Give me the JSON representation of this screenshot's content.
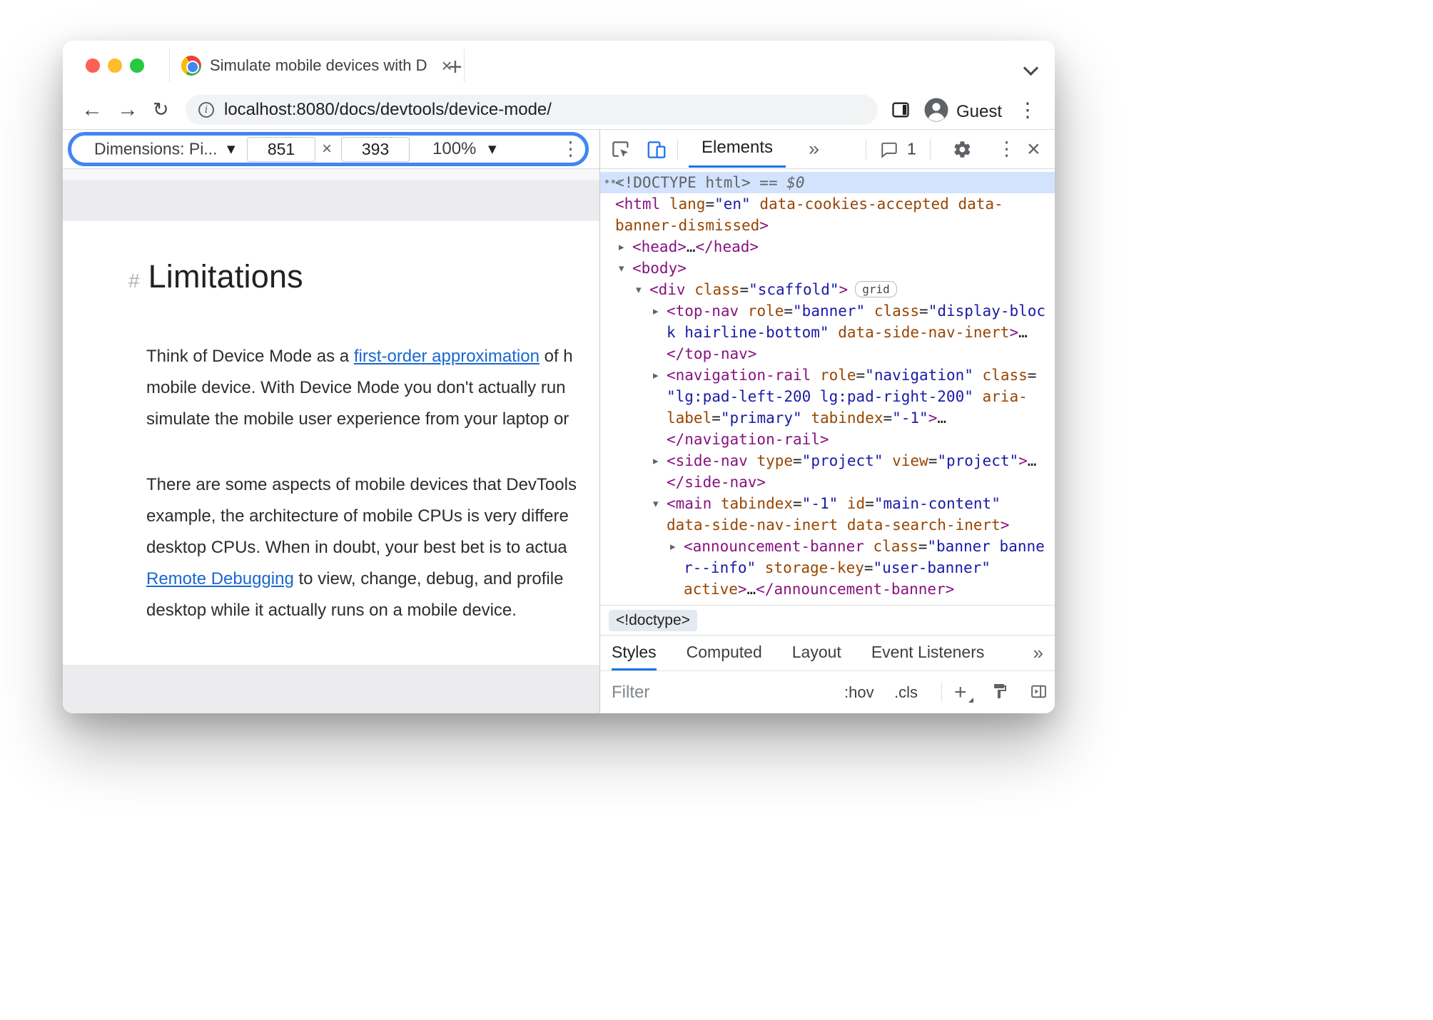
{
  "colors": {
    "highlight_ring": "#4285f4",
    "devtools_accent": "#1a73e8",
    "selected_node_bg": "#d3e3fd",
    "code_tag": "#881280",
    "code_attr": "#994500",
    "code_value": "#1a1aa6",
    "link": "#1967d2",
    "traffic_red": "#ff5f57",
    "traffic_yellow": "#febc2e",
    "traffic_green": "#28c840"
  },
  "icons": {
    "back": "←",
    "forward": "→",
    "reload": "↻",
    "menu": "⋮",
    "close": "×",
    "caret": "▼",
    "more": "»",
    "plus": "+",
    "times": "×",
    "info": "i"
  },
  "titlebar": {
    "tab_title": "Simulate mobile devices with D"
  },
  "navbar": {
    "url": "localhost:8080/docs/devtools/device-mode/",
    "profile": "Guest"
  },
  "device_toolbar": {
    "dimensions": "Dimensions: Pi...",
    "width": "851",
    "height": "393",
    "zoom": "100%"
  },
  "page": {
    "anchor": "#",
    "heading": "Limitations",
    "p1": [
      {
        "pre": "Think of Device Mode as a ",
        "link": "first-order approximation",
        "post": " of h"
      },
      {
        "text": "mobile device. With Device Mode you don't actually run"
      },
      {
        "text": "simulate the mobile user experience from your laptop or"
      }
    ],
    "p2": [
      {
        "text": "There are some aspects of mobile devices that DevTools"
      },
      {
        "text": "example, the architecture of mobile CPUs is very differe"
      },
      {
        "text": "desktop CPUs. When in doubt, your best bet is to actua"
      },
      {
        "link": "Remote Debugging",
        "post": " to view, change, debug, and profile"
      },
      {
        "text": "desktop while it actually runs on a mobile device."
      }
    ]
  },
  "devtools": {
    "elements_tab": "Elements",
    "console_count": "1",
    "breadcrumb": "<!doctype>",
    "bottom_tabs": [
      "Styles",
      "Computed",
      "Layout",
      "Event Listeners"
    ],
    "filter_placeholder": "Filter",
    "hov": ":hov",
    "cls": ".cls",
    "dom_lines": [
      {
        "ind": 0,
        "sel": true,
        "tokens": [
          [
            "dots",
            "•••"
          ],
          [
            "meta",
            "<!DOCTYPE html>"
          ],
          [
            "dollar",
            " == $0"
          ]
        ]
      },
      {
        "ind": 0,
        "tokens": [
          [
            "tag",
            "<html"
          ],
          [
            "attr",
            " lang"
          ],
          [
            "plain",
            "="
          ],
          [
            "val",
            "\"en\""
          ],
          [
            "attr",
            " data-cookies-accepted"
          ],
          [
            "attr",
            " data-"
          ]
        ]
      },
      {
        "ind": 0,
        "tokens": [
          [
            "attr",
            "banner-dismissed"
          ],
          [
            "tag",
            ">"
          ]
        ]
      },
      {
        "ind": 1,
        "arrow": "r",
        "tokens": [
          [
            "tag",
            "<head>"
          ],
          [
            "plain",
            "…"
          ],
          [
            "tag",
            "</head>"
          ]
        ]
      },
      {
        "ind": 1,
        "arrow": "d",
        "tokens": [
          [
            "tag",
            "<body>"
          ]
        ]
      },
      {
        "ind": 2,
        "arrow": "d",
        "badge": "grid",
        "tokens": [
          [
            "tag",
            "<div"
          ],
          [
            "attr",
            " class"
          ],
          [
            "plain",
            "="
          ],
          [
            "val",
            "\"scaffold\""
          ],
          [
            "tag",
            ">"
          ]
        ]
      },
      {
        "ind": 3,
        "arrow": "r",
        "tokens": [
          [
            "tag",
            "<top-nav"
          ],
          [
            "attr",
            " role"
          ],
          [
            "plain",
            "="
          ],
          [
            "val",
            "\"banner\""
          ],
          [
            "attr",
            " class"
          ],
          [
            "plain",
            "="
          ],
          [
            "val",
            "\"display-bloc"
          ]
        ]
      },
      {
        "ind": 3,
        "tokens": [
          [
            "val",
            "k hairline-bottom\""
          ],
          [
            "attr",
            " data-side-nav-inert"
          ],
          [
            "tag",
            ">"
          ],
          [
            "plain",
            "…"
          ]
        ]
      },
      {
        "ind": 3,
        "tokens": [
          [
            "tag",
            "</top-nav>"
          ]
        ]
      },
      {
        "ind": 3,
        "arrow": "r",
        "tokens": [
          [
            "tag",
            "<navigation-rail"
          ],
          [
            "attr",
            " role"
          ],
          [
            "plain",
            "="
          ],
          [
            "val",
            "\"navigation\""
          ],
          [
            "attr",
            " class"
          ],
          [
            "plain",
            "="
          ]
        ]
      },
      {
        "ind": 3,
        "tokens": [
          [
            "val",
            "\"lg:pad-left-200 lg:pad-right-200\""
          ],
          [
            "attr",
            " aria-"
          ]
        ]
      },
      {
        "ind": 3,
        "tokens": [
          [
            "attr",
            "label"
          ],
          [
            "plain",
            "="
          ],
          [
            "val",
            "\"primary\""
          ],
          [
            "attr",
            " tabindex"
          ],
          [
            "plain",
            "="
          ],
          [
            "val",
            "\"-1\""
          ],
          [
            "tag",
            ">"
          ],
          [
            "plain",
            "…"
          ]
        ]
      },
      {
        "ind": 3,
        "tokens": [
          [
            "tag",
            "</navigation-rail>"
          ]
        ]
      },
      {
        "ind": 3,
        "arrow": "r",
        "tokens": [
          [
            "tag",
            "<side-nav"
          ],
          [
            "attr",
            " type"
          ],
          [
            "plain",
            "="
          ],
          [
            "val",
            "\"project\""
          ],
          [
            "attr",
            " view"
          ],
          [
            "plain",
            "="
          ],
          [
            "val",
            "\"project\""
          ],
          [
            "tag",
            ">"
          ],
          [
            "plain",
            "…"
          ]
        ]
      },
      {
        "ind": 3,
        "tokens": [
          [
            "tag",
            "</side-nav>"
          ]
        ]
      },
      {
        "ind": 3,
        "arrow": "d",
        "tokens": [
          [
            "tag",
            "<main"
          ],
          [
            "attr",
            " tabindex"
          ],
          [
            "plain",
            "="
          ],
          [
            "val",
            "\"-1\""
          ],
          [
            "attr",
            " id"
          ],
          [
            "plain",
            "="
          ],
          [
            "val",
            "\"main-content\""
          ]
        ]
      },
      {
        "ind": 3,
        "tokens": [
          [
            "attr",
            "data-side-nav-inert"
          ],
          [
            "attr",
            " data-search-inert"
          ],
          [
            "tag",
            ">"
          ]
        ]
      },
      {
        "ind": 4,
        "arrow": "r",
        "tokens": [
          [
            "tag",
            "<announcement-banner"
          ],
          [
            "attr",
            " class"
          ],
          [
            "plain",
            "="
          ],
          [
            "val",
            "\"banner banne"
          ]
        ]
      },
      {
        "ind": 4,
        "tokens": [
          [
            "val",
            "r--info\""
          ],
          [
            "attr",
            " storage-key"
          ],
          [
            "plain",
            "="
          ],
          [
            "val",
            "\"user-banner\""
          ]
        ]
      },
      {
        "ind": 4,
        "tokens": [
          [
            "attr",
            "active"
          ],
          [
            "tag",
            ">"
          ],
          [
            "plain",
            "…"
          ],
          [
            "tag",
            "</announcement-banner>"
          ]
        ]
      }
    ]
  }
}
